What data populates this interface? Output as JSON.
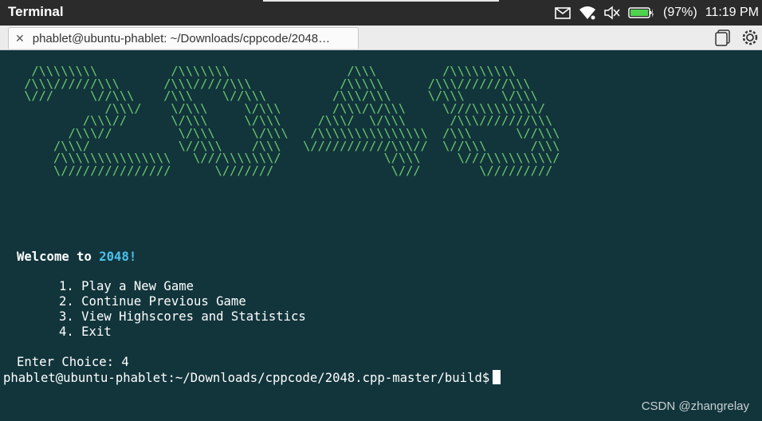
{
  "topbar": {
    "app_title": "Terminal",
    "battery": "(97%)",
    "time": "11:19 PM"
  },
  "tab": {
    "title": "phablet@ubuntu-phablet: ~/Downloads/cppcode/2048…"
  },
  "icons": [
    "mail-icon",
    "wifi-icon",
    "volume-muted-icon",
    "battery-icon",
    "close-icon",
    "new-tab-icon",
    "settings-icon"
  ],
  "terminal": {
    "ascii_art": "  /\\\\\\\\\\\\\\\\          /\\\\\\\\\\\\\\                /\\\\\\         /\\\\\\\\\\\\\\\\\\\n /\\\\\\//////\\\\\\      /\\\\\\/////\\\\\\            /\\\\\\\\\\      /\\\\\\///////\\\\\\\n \\///     \\//\\\\\\    /\\\\\\    \\//\\\\\\         /\\\\\\/\\\\\\     \\/\\\\\\     \\/\\\\\\\n            /\\\\\\/    \\/\\\\\\     \\/\\\\\\       /\\\\\\/\\/\\\\\\     \\///\\\\\\\\\\\\\\\\\\/\n         /\\\\\\//      \\/\\\\\\     \\/\\\\\\     /\\\\\\/  \\/\\\\\\      /\\\\\\///////\\\\\\\n       /\\\\\\//         \\/\\\\\\     \\/\\\\\\   /\\\\\\\\\\\\\\\\\\\\\\\\\\\\\\  /\\\\\\      \\//\\\\\\\n     /\\\\\\/            \\//\\\\\\    /\\\\\\   \\///////////\\\\\\//  \\//\\\\\\      /\\\\\\\n     /\\\\\\\\\\\\\\\\\\\\\\\\\\\\\\   \\///\\\\\\\\\\\\\\/              \\/\\\\\\     \\///\\\\\\\\\\\\\\\\\\/\n     \\///////////////      \\///////                \\///        \\/////////",
    "welcome_prefix": "Welcome to ",
    "welcome_number": "2048!",
    "menu": [
      "1. Play a New Game",
      "2. Continue Previous Game",
      "3. View Highscores and Statistics",
      "4. Exit"
    ],
    "prompt_line": "Enter Choice: 4",
    "shell_prompt": "phablet@ubuntu-phablet:~/Downloads/cppcode/2048.cpp-master/build$"
  },
  "watermark": "CSDN @zhangrelay",
  "colors": {
    "terminal_bg": "#12353c",
    "ascii_green": "#6ec86e",
    "accent_blue": "#4cc1ec",
    "topbar_bg": "#2b2b2b"
  }
}
